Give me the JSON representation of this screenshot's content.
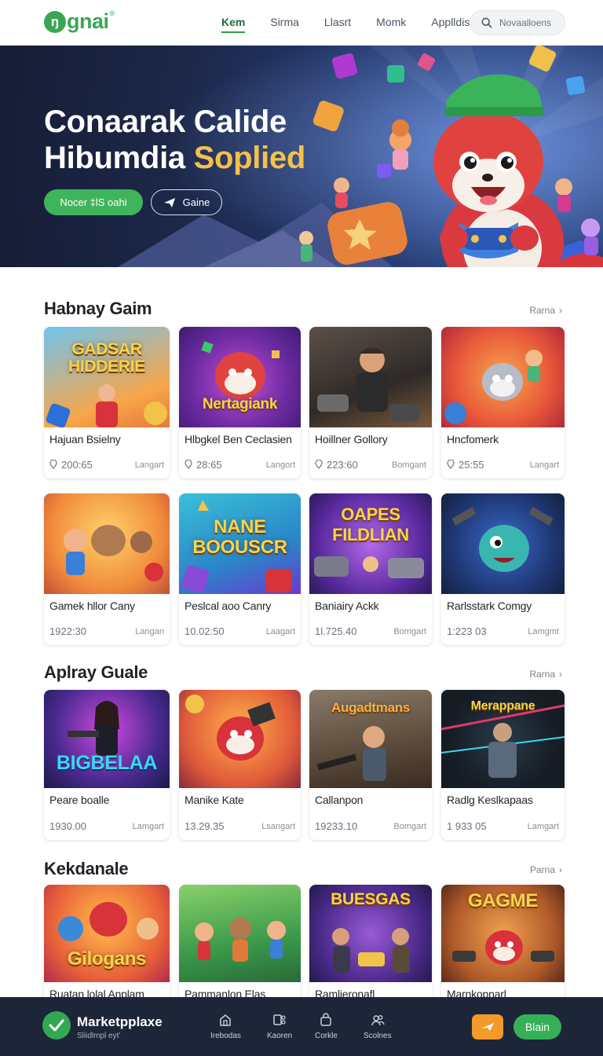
{
  "header": {
    "logo_text": "gnai",
    "logo_mark": "ŋ",
    "logo_sup": "®",
    "nav": [
      {
        "label": "Kem",
        "active": true
      },
      {
        "label": "Sirma",
        "active": false
      },
      {
        "label": "Llasrt",
        "active": false
      },
      {
        "label": "Momk",
        "active": false
      },
      {
        "label": "Applldis",
        "active": false
      }
    ],
    "search_placeholder": "Novaalloens"
  },
  "hero": {
    "title_line1": "Conaarak Calide",
    "title_line2_plain": "Hibumdia",
    "title_line2_accent": "Soplied",
    "cta_label": "Nocer ‡lS oahi",
    "secondary_label": "Gaine"
  },
  "sections": [
    {
      "title": "Habnay Gaim",
      "link": "Rarna",
      "cards": [
        {
          "thumb_text": "GADSAR HIDDERIE",
          "title": "Hajuan Bsielny",
          "meta": "200:65",
          "tag": "Langart"
        },
        {
          "thumb_text": "Nertagiank",
          "title": "Hlbgkel Ben Ceclasien",
          "meta": "28:65",
          "tag": "Langort"
        },
        {
          "thumb_text": "",
          "title": "Hoillner Gollory",
          "meta": "223:60",
          "tag": "Bomgant"
        },
        {
          "thumb_text": "",
          "title": "Hncfomerk",
          "meta": "25:55",
          "tag": "Langart"
        },
        {
          "thumb_text": "",
          "title": "Gamek hllor Cany",
          "meta": "1922:30",
          "tag": "Langan"
        },
        {
          "thumb_text": "NANE BOOUSCR",
          "title": "Peslcal aoo Canry",
          "meta": "10.02:50",
          "tag": "Laagart"
        },
        {
          "thumb_text": "OAPES FILDLIAN",
          "title": "Baniairy Ackk",
          "meta": "1l.725.40",
          "tag": "Bomgart"
        },
        {
          "thumb_text": "",
          "title": "Rarlsstark Comgy",
          "meta": "1:223 03",
          "tag": "Lamgmt"
        }
      ]
    },
    {
      "title": "Aplray Guale",
      "link": "Rarna",
      "cards": [
        {
          "thumb_text": "BIGBELAA",
          "title": "Peare boalle",
          "meta": "1930.00",
          "tag": "Lamgart"
        },
        {
          "thumb_text": "",
          "title": "Manike Kate",
          "meta": "13.29.35",
          "tag": "Lsangart"
        },
        {
          "thumb_text": "Augadtmans",
          "title": "Callanpon",
          "meta": "19233.10",
          "tag": "Bomgart"
        },
        {
          "thumb_text": "Merappane",
          "title": "Radlg Keslkapaas",
          "meta": "1 933 05",
          "tag": "Lamgart"
        }
      ]
    },
    {
      "title": "Kekdanale",
      "link": "Parna",
      "cards": [
        {
          "thumb_text": "Gilogans",
          "title": "Ruatan lolal   Anplam",
          "meta": "",
          "tag": ""
        },
        {
          "thumb_text": "",
          "title": "Pammanlon Elas",
          "meta": "",
          "tag": ""
        },
        {
          "thumb_text": "BUESGAS",
          "title": "Ramlieronafl",
          "meta": "",
          "tag": ""
        },
        {
          "thumb_text": "GAGME",
          "title": "Marnkopnarl",
          "meta": "",
          "tag": ""
        }
      ]
    }
  ],
  "bottombar": {
    "brand": "Marketpplaxe",
    "brand_sub": "Sliidlmpl eyt'",
    "nav": [
      "Irebodas",
      "Kaoren",
      "Corkle",
      "Scolnes"
    ],
    "primary_label": "Blain"
  }
}
